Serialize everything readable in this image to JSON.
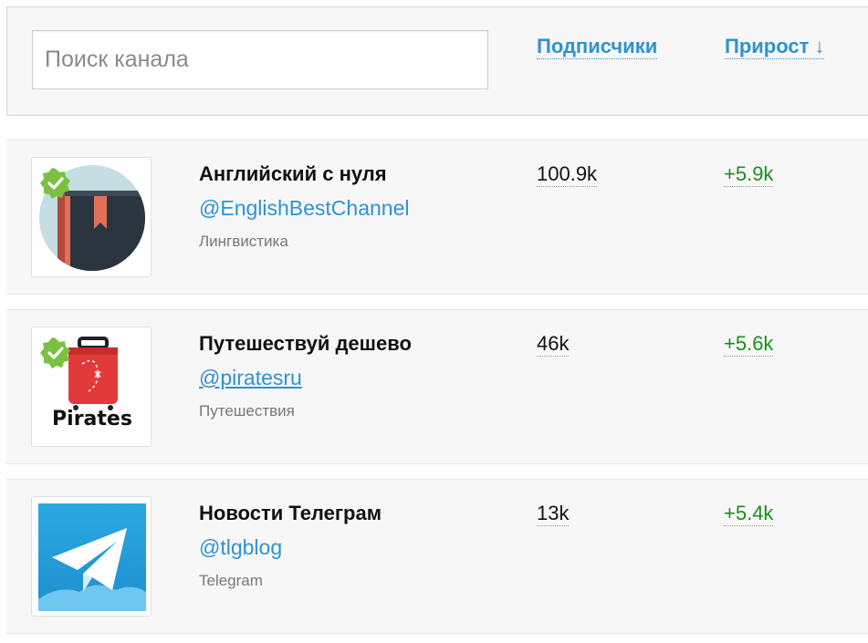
{
  "search": {
    "placeholder": "Поиск канала",
    "value": ""
  },
  "columns": {
    "subscribers": "Подписчики",
    "growth": "Прирост",
    "sort_arrow": "↓"
  },
  "channels": [
    {
      "title": "Английский с нуля",
      "handle": "@EnglishBestChannel",
      "category": "Лингвистика",
      "subscribers": "100.9k",
      "growth": "+5.9k",
      "verified": true,
      "icon": "book-icon"
    },
    {
      "title": "Путешествуй дешево",
      "handle": "@piratesru",
      "category": "Путешествия",
      "subscribers": "46k",
      "growth": "+5.6k",
      "verified": true,
      "icon": "suitcase-icon",
      "logo_text": "Pirates"
    },
    {
      "title": "Новости Телеграм",
      "handle": "@tlgblog",
      "category": "Telegram",
      "subscribers": "13k",
      "growth": "+5.4k",
      "verified": false,
      "icon": "telegram-plane-icon"
    }
  ],
  "colors": {
    "accent": "#2e92d1",
    "growth": "#1a8f1a",
    "verified": "#7ac142"
  }
}
